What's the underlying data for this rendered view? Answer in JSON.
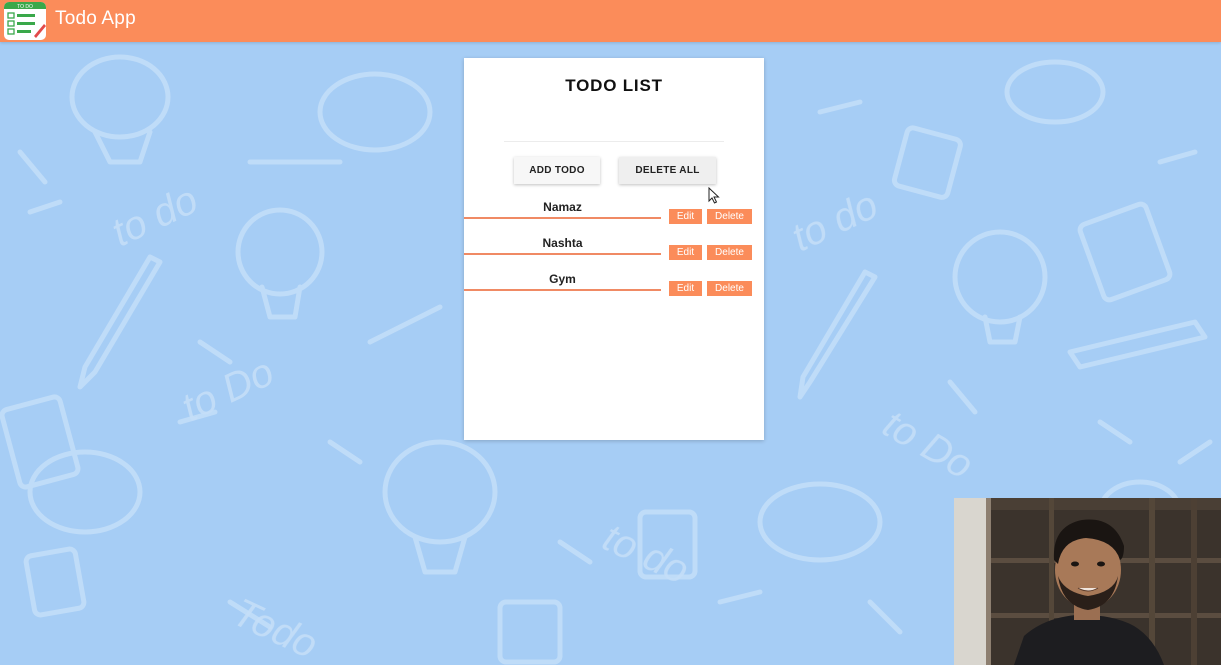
{
  "app": {
    "title": "Todo App",
    "logo_label": "TO DO",
    "accent_color": "#fb8c5a",
    "background_color": "#a6cdf5"
  },
  "card": {
    "title": "TODO LIST",
    "add_button": "ADD TODO",
    "delete_all_button": "DELETE ALL"
  },
  "todos": [
    {
      "text": "Namaz",
      "edit": "Edit",
      "delete": "Delete"
    },
    {
      "text": "Nashta",
      "edit": "Edit",
      "delete": "Delete"
    },
    {
      "text": "Gym",
      "edit": "Edit",
      "delete": "Delete"
    }
  ],
  "icons": {
    "logo": "todo-list-icon",
    "cursor": "mouse-pointer-icon"
  }
}
